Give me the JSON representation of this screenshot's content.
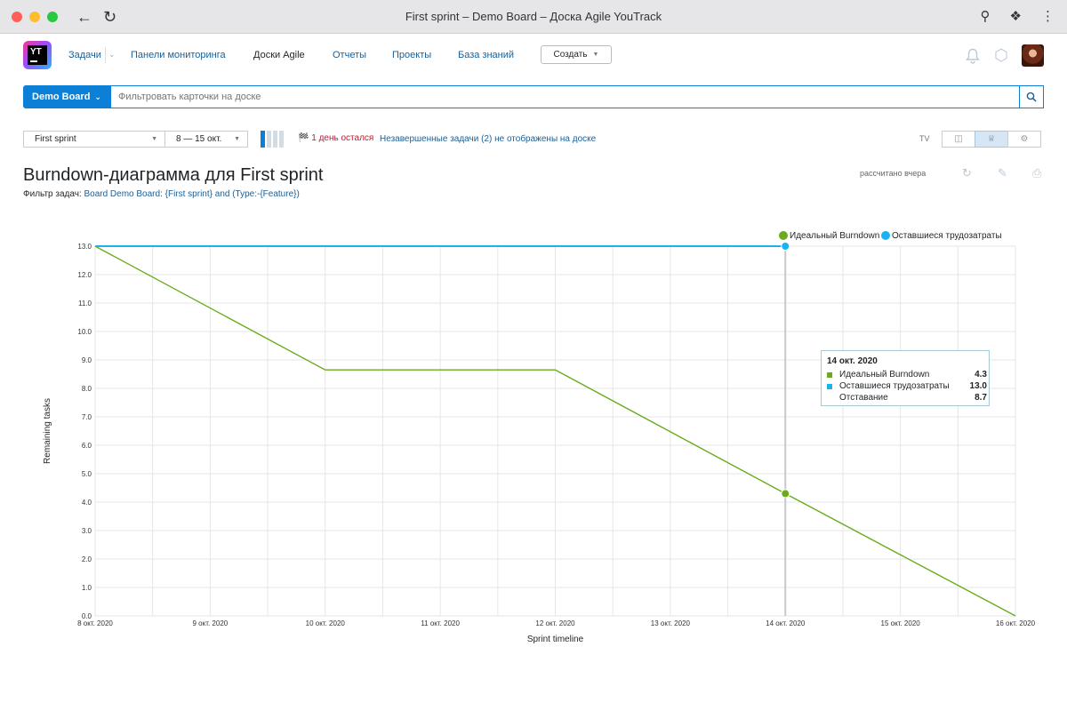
{
  "browser": {
    "tab_title": "First sprint – Demo Board – Доска Agile YouTrack"
  },
  "app": {
    "logo_text": "YT",
    "nav": {
      "issues": "Задачи",
      "dashboards": "Панели мониторинга",
      "agile_boards": "Доски Agile",
      "reports": "Отчеты",
      "projects": "Проекты",
      "knowledge_base": "База знаний"
    },
    "create_label": "Создать"
  },
  "search": {
    "board_label": "Demo Board",
    "placeholder": "Фильтровать карточки на доске"
  },
  "toolbar": {
    "sprint": "First sprint",
    "dates": "8 — 15 окт.",
    "days_left": "1 день остался",
    "unresolved_link": "Незавершенные задачи (2) не отображены на доске",
    "tv_label": "TV"
  },
  "report": {
    "title": "Burndown-диаграмма для First sprint",
    "filter_label": "Фильтр задач:",
    "filter_query": "Board Demo Board: {First sprint} and (Type:-{Feature})",
    "calculated": "рассчитано вчера"
  },
  "colors": {
    "accent": "#0c7fd6",
    "ideal": "#6aac1d",
    "remaining": "#1ab2f0",
    "link": "#1a5f96",
    "flag": "#c0182f"
  },
  "chart_data": {
    "type": "line",
    "xlabel": "Sprint timeline",
    "ylabel": "Remaining tasks",
    "ylim": [
      0,
      13
    ],
    "xlim": [
      0,
      8
    ],
    "x_tick_labels": [
      "8 окт. 2020",
      "9 окт. 2020",
      "10 окт. 2020",
      "11 окт. 2020",
      "12 окт. 2020",
      "13 окт. 2020",
      "14 окт. 2020",
      "15 окт. 2020",
      "16 окт. 2020"
    ],
    "y_tick_labels": [
      "0.0",
      "1.0",
      "2.0",
      "3.0",
      "4.0",
      "5.0",
      "6.0",
      "7.0",
      "8.0",
      "9.0",
      "10.0",
      "11.0",
      "12.0",
      "13.0"
    ],
    "legend_position": "top-right",
    "grid": true,
    "series": [
      {
        "name": "Идеальный Burndown",
        "color": "#6aac1d",
        "points": [
          [
            0,
            13.0
          ],
          [
            2,
            8.65
          ],
          [
            4,
            8.65
          ],
          [
            6,
            4.3
          ],
          [
            8,
            0.0
          ]
        ]
      },
      {
        "name": "Оставшиеся трудозатраты",
        "color": "#1ab2f0",
        "points": [
          [
            0,
            13.0
          ],
          [
            6,
            13.0
          ]
        ]
      }
    ],
    "highlight": {
      "x": 6,
      "date": "14 окт. 2020",
      "rows": [
        {
          "name": "Идеальный Burndown",
          "value": "4.3",
          "color": "#6aac1d"
        },
        {
          "name": "Оставшиеся трудозатраты",
          "value": "13.0",
          "color": "#1ab2f0"
        },
        {
          "name": "Отставание",
          "value": "8.7",
          "color": ""
        }
      ]
    }
  }
}
